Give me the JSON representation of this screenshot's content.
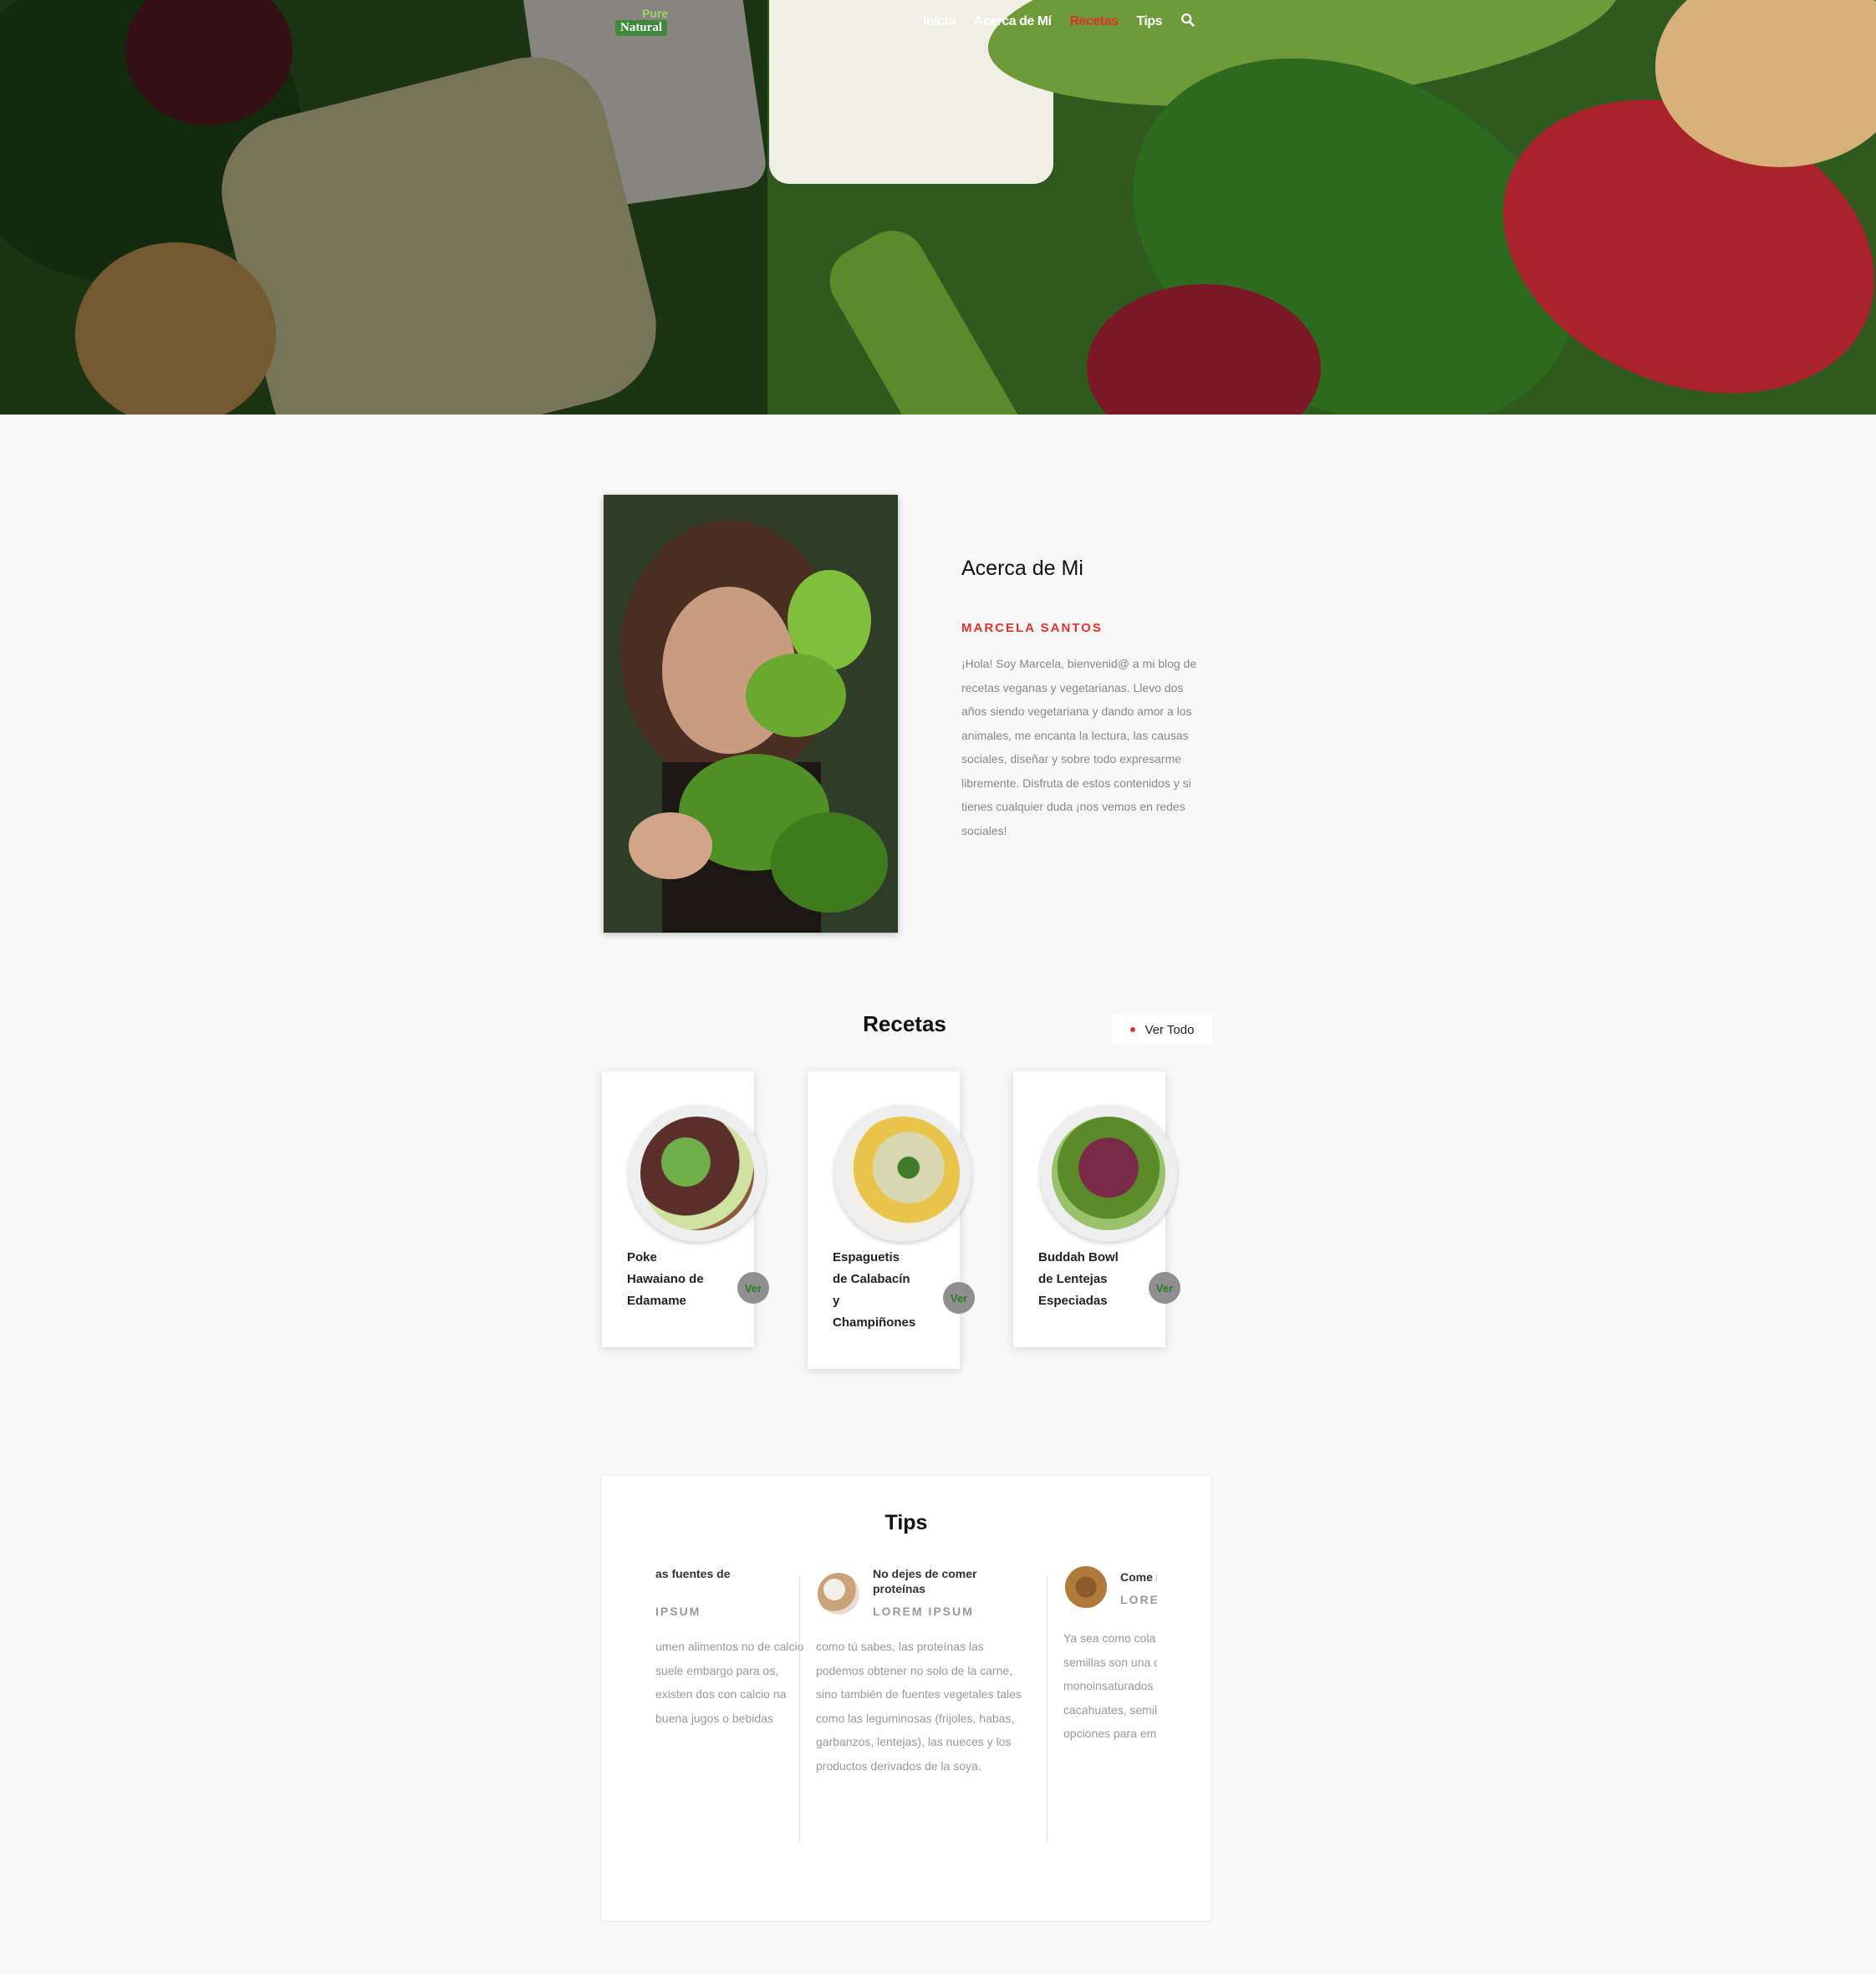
{
  "logo": {
    "line1": "Pure",
    "line2": "Natural"
  },
  "nav": {
    "items": [
      {
        "label": "Inicio"
      },
      {
        "label": "Acerca de Mí"
      },
      {
        "label": "Recetas"
      },
      {
        "label": "Tips"
      }
    ],
    "active": "Recetas",
    "search_icon": "search-icon"
  },
  "about": {
    "title": "Acerca de Mi",
    "name": "MARCELA SANTOS",
    "text": "¡Hola! Soy Marcela, bienvenid@ a mi blog de recetas veganas y vegetarianas. Llevo dos años siendo vegetariana y dando amor a los animales, me encanta la lectura, las causas sociales, diseñar y sobre todo expresarme libremente. Disfruta de estos contenidos y si tienes cualquier duda ¡nos vemos en redes sociales!"
  },
  "recipes": {
    "title": "Recetas",
    "see_all": "Ver Todo",
    "items": [
      {
        "title": "Poke Hawaiano de Edamame",
        "button": "Ver"
      },
      {
        "title": "Espaguetis de Calabacín y Champiñones",
        "button": "Ver"
      },
      {
        "title": "Buddah Bowl de Lentejas Especiadas",
        "button": "Ver"
      }
    ]
  },
  "tips": {
    "title": "Tips",
    "items": [
      {
        "title": "as fuentes de",
        "subtitle": "IPSUM",
        "text": "umen alimentos no de calcio suele embargo para os, existen dos con calcio na buena jugos o bebidas"
      },
      {
        "title": "No dejes de comer proteínas",
        "subtitle": "LOREM IPSUM",
        "text": "como tú sabes, las proteínas las podemos obtener no solo de la carne, sino también de fuentes vegetales tales como las leguminosas (frijoles, habas, garbanzos, lentejas), las nueces y los productos derivados de la soya."
      },
      {
        "title": "Come n",
        "subtitle": "LOREM",
        "text": "Ya sea como cola parte de un platil semillas son una de proteína y ácic monoinsaturados de calabaza, nuec cacahuates, semil chía, todas son e opciones para em e incluso bebidas"
      }
    ]
  },
  "colors": {
    "accent": "#e0332d",
    "green": "#3f8a3a",
    "background": "#f8f8f8"
  }
}
